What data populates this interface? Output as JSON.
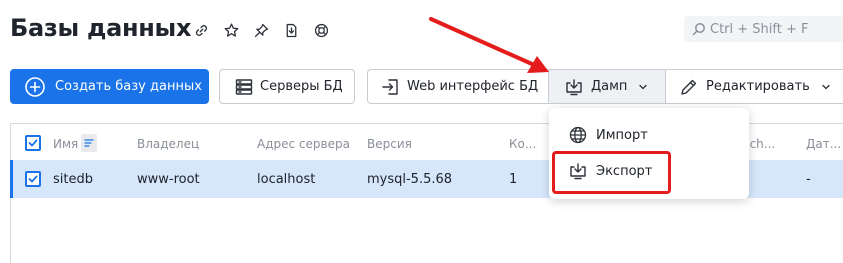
{
  "page": {
    "title": "Базы данных"
  },
  "title_icons": [
    "link-icon",
    "star-icon",
    "pin-icon",
    "save-icon",
    "help-icon"
  ],
  "search": {
    "shortcut": "Ctrl + Shift + F",
    "icon": "search-icon"
  },
  "toolbar": {
    "create_label": "Создать базу данных",
    "servers_label": "Серверы БД",
    "web_label": "Web интерфейс БД",
    "dump_label": "Дамп",
    "edit_label": "Редактировать"
  },
  "table": {
    "headers": [
      "Имя",
      "Владелец",
      "Адрес сервера",
      "Версия",
      "Ко...",
      "Sqlch...",
      "Дат..."
    ],
    "rows": [
      {
        "name": "sitedb",
        "owner": "www-root",
        "address": "localhost",
        "version": "mysql-5.5.68",
        "count": "1",
        "date": "-"
      }
    ]
  },
  "dropdown": {
    "items": [
      {
        "label": "Импорт",
        "icon": "globe-icon"
      },
      {
        "label": "Экспорт",
        "icon": "download-icon"
      }
    ]
  },
  "colors": {
    "accent": "#1a73e8",
    "highlight": "#e51c1c",
    "row_selected": "#d6e7fb"
  }
}
